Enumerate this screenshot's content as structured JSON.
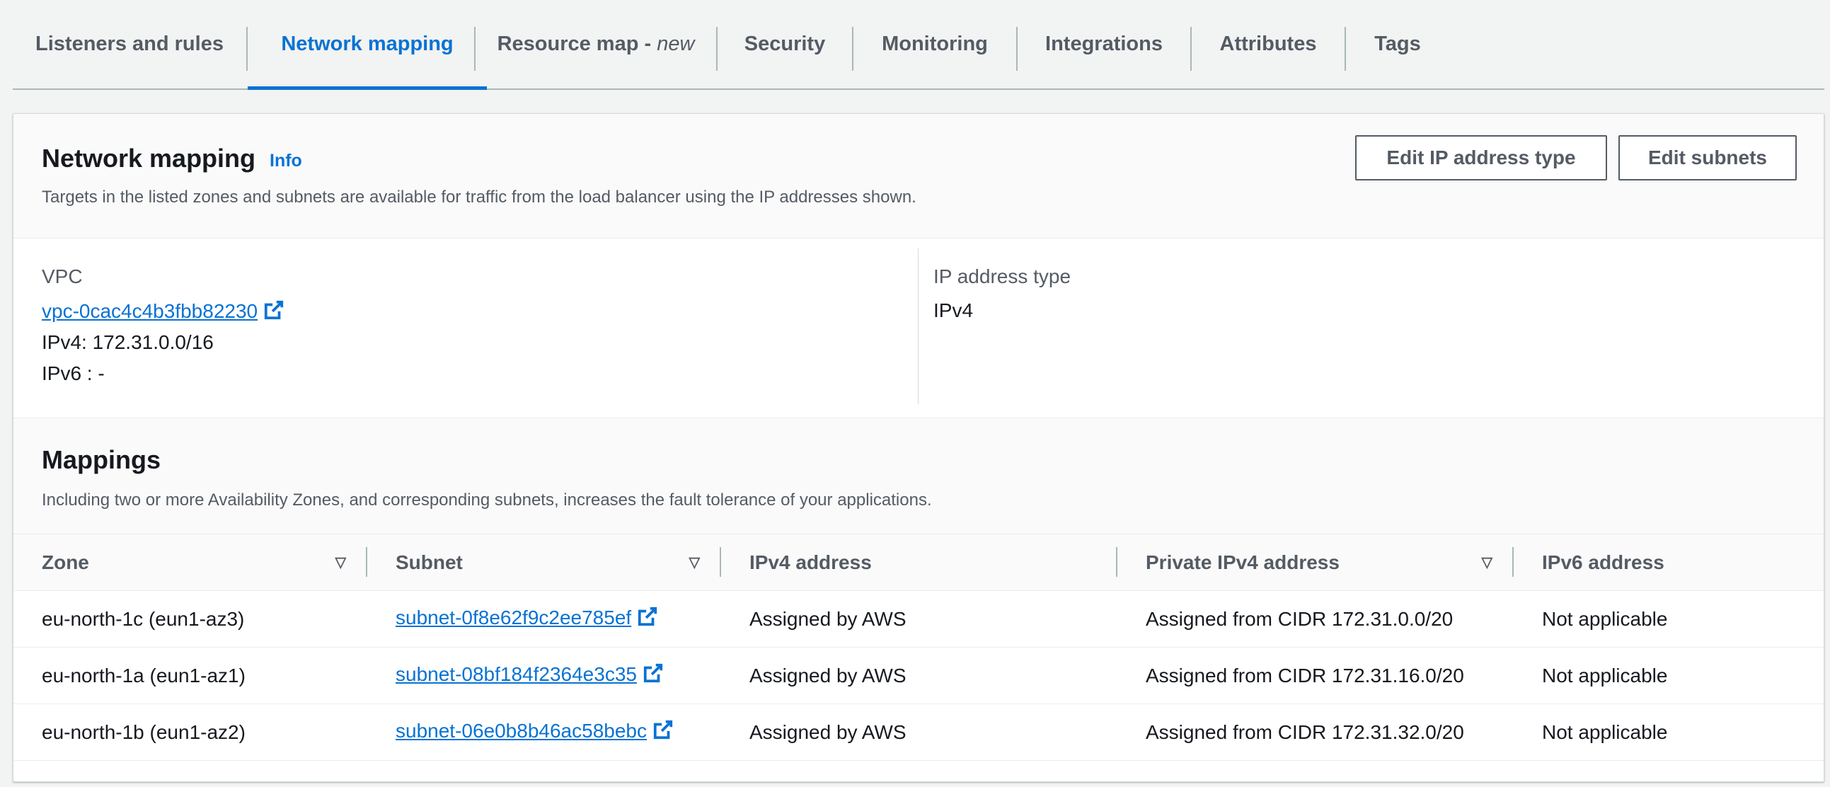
{
  "tabs": [
    {
      "label": "Listeners and rules"
    },
    {
      "label": "Network mapping"
    },
    {
      "label": "Resource map - ",
      "suffix": "new"
    },
    {
      "label": "Security"
    },
    {
      "label": "Monitoring"
    },
    {
      "label": "Integrations"
    },
    {
      "label": "Attributes"
    },
    {
      "label": "Tags"
    }
  ],
  "header": {
    "title": "Network mapping",
    "info": "Info",
    "description": "Targets in the listed zones and subnets are available for traffic from the load balancer using the IP addresses shown.",
    "edit_ip_button": "Edit IP address type",
    "edit_subnets_button": "Edit subnets"
  },
  "vpc": {
    "label": "VPC",
    "id": "vpc-0cac4c4b3fbb82230",
    "ipv4": "IPv4: 172.31.0.0/16",
    "ipv6": "IPv6 : -"
  },
  "ip_type": {
    "label": "IP address type",
    "value": "IPv4"
  },
  "mappings": {
    "title": "Mappings",
    "description": "Including two or more Availability Zones, and corresponding subnets, increases the fault tolerance of your applications.",
    "columns": [
      "Zone",
      "Subnet",
      "IPv4 address",
      "Private IPv4 address",
      "IPv6 address"
    ],
    "rows": [
      {
        "zone": "eu-north-1c (eun1-az3)",
        "subnet": "subnet-0f8e62f9c2ee785ef",
        "ipv4": "Assigned by AWS",
        "private_ipv4": "Assigned from CIDR 172.31.0.0/20",
        "ipv6": "Not applicable"
      },
      {
        "zone": "eu-north-1a (eun1-az1)",
        "subnet": "subnet-08bf184f2364e3c35",
        "ipv4": "Assigned by AWS",
        "private_ipv4": "Assigned from CIDR 172.31.16.0/20",
        "ipv6": "Not applicable"
      },
      {
        "zone": "eu-north-1b (eun1-az2)",
        "subnet": "subnet-06e0b8b46ac58bebc",
        "ipv4": "Assigned by AWS",
        "private_ipv4": "Assigned from CIDR 172.31.32.0/20",
        "ipv6": "Not applicable"
      }
    ]
  },
  "icons": {
    "external_link": "external-link-icon",
    "sort": "sort-caret-icon"
  },
  "colors": {
    "accent": "#0972d3",
    "text": "#16191f",
    "muted": "#545b64",
    "border": "#aab7b8"
  }
}
